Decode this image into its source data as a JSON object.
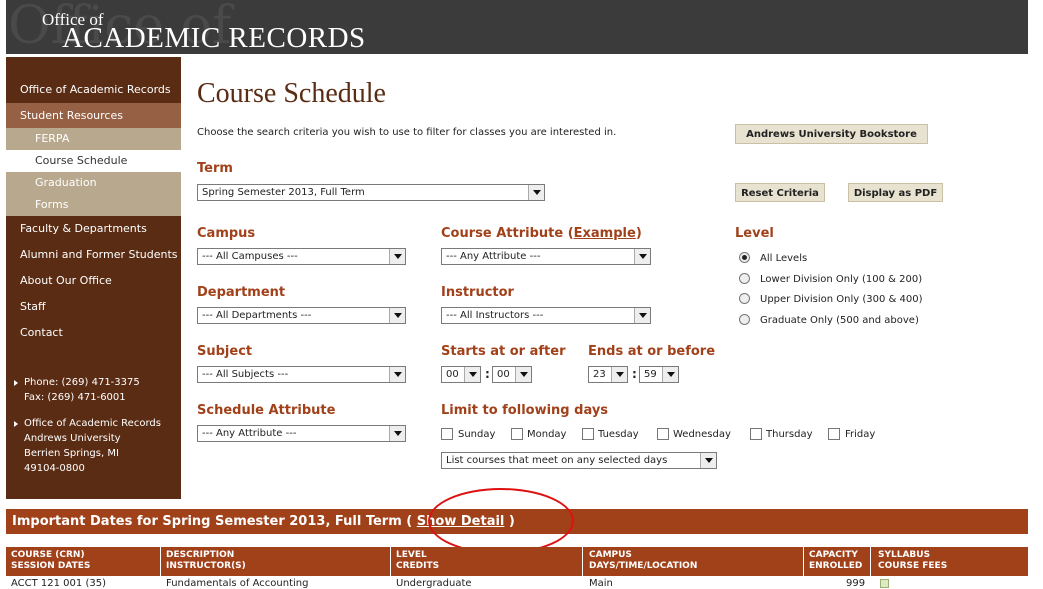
{
  "header": {
    "ghost": "Office of",
    "line1": "Office of",
    "line2": "ACADEMIC RECORDS"
  },
  "sidebar": {
    "items": [
      {
        "label": "Office of Academic Records"
      },
      {
        "label": "Student Resources"
      },
      {
        "label": "FERPA"
      },
      {
        "label": "Course Schedule"
      },
      {
        "label": "Graduation"
      },
      {
        "label": "Forms"
      },
      {
        "label": "Faculty & Departments"
      },
      {
        "label": "Alumni and Former Students"
      },
      {
        "label": "About Our Office"
      },
      {
        "label": "Staff"
      },
      {
        "label": "Contact"
      }
    ],
    "phone": "Phone: (269) 471-3375",
    "fax": "Fax: (269) 471-6001",
    "address": [
      "Office of Academic Records",
      "Andrews University",
      "Berrien Springs, MI",
      "49104-0800"
    ]
  },
  "main": {
    "title": "Course Schedule",
    "intro": "Choose the search criteria you wish to use to filter for classes you are interested in.",
    "bookstore": "Andrews University Bookstore",
    "reset": "Reset Criteria",
    "pdf": "Display as PDF",
    "term": {
      "label": "Term",
      "value": "Spring Semester 2013, Full Term"
    },
    "campus": {
      "label": "Campus",
      "value": "--- All Campuses ---"
    },
    "attribute": {
      "label": "Course Attribute (",
      "link": "Example",
      "close": ")",
      "value": "--- Any Attribute ---"
    },
    "level": {
      "label": "Level",
      "options": [
        "All Levels",
        "Lower Division Only (100 & 200)",
        "Upper Division Only (300 & 400)",
        "Graduate Only (500 and above)"
      ]
    },
    "department": {
      "label": "Department",
      "value": "--- All Departments ---"
    },
    "instructor": {
      "label": "Instructor",
      "value": "--- All Instructors ---"
    },
    "subject": {
      "label": "Subject",
      "value": "--- All Subjects ---"
    },
    "starts": {
      "label": "Starts at or after",
      "hour": "00",
      "minute": "00"
    },
    "ends": {
      "label": "Ends at or before",
      "hour": "23",
      "minute": "59"
    },
    "schedule_attr": {
      "label": "Schedule Attribute",
      "value": "--- Any Attribute ---"
    },
    "days": {
      "label": "Limit to following days",
      "items": [
        "Sunday",
        "Monday",
        "Tuesday",
        "Wednesday",
        "Thursday",
        "Friday"
      ],
      "mode": "List courses that meet on any selected days"
    },
    "banner": {
      "text": "Important Dates for Spring Semester 2013, Full Term",
      "open": "(",
      "link": "Show Detail",
      "close": ")"
    },
    "table": {
      "headers": [
        [
          "COURSE (CRN)",
          "SESSION DATES"
        ],
        [
          "DESCRIPTION",
          "INSTRUCTOR(S)"
        ],
        [
          "LEVEL",
          "CREDITS"
        ],
        [
          "CAMPUS",
          "DAYS/TIME/LOCATION"
        ],
        [
          "CAPACITY",
          "ENROLLED"
        ],
        [
          "SYLLABUS",
          "COURSE FEES"
        ]
      ],
      "row": {
        "course": "ACCT 121 001 (35)",
        "description": "Fundamentals of Accounting",
        "level": "Undergraduate",
        "campus": "Main",
        "capacity": "999"
      }
    }
  }
}
